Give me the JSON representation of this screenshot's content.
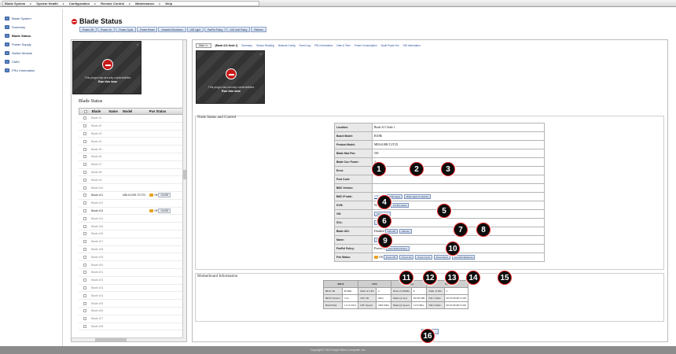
{
  "topbar": {
    "items": [
      "Blade System",
      "System Health",
      "Configuration",
      "Remote Control",
      "Maintenance",
      "Help"
    ]
  },
  "nav": {
    "items": [
      {
        "label": "Blade System",
        "active": false
      },
      {
        "label": "Summary",
        "active": false
      },
      {
        "label": "Blade Status",
        "active": true
      },
      {
        "label": "Power Supply",
        "active": false
      },
      {
        "label": "Switch Module",
        "active": false
      },
      {
        "label": "CMM",
        "active": false
      },
      {
        "label": "FRU Information",
        "active": false
      }
    ]
  },
  "header": {
    "title": "Blade Status",
    "power_buttons": [
      "Power Off",
      "Power On",
      "Power Cycle",
      "Power Reset",
      "Graceful Shutdown",
      "UID Light",
      "PwrPol Policy",
      "UID Ledt Policy",
      "Refresh"
    ]
  },
  "plugin": {
    "message": "This plugin has security vulnerabilities",
    "action": "Run this time",
    "close": "×"
  },
  "blade_status": {
    "title": "Blade Status",
    "columns": [
      "Blade",
      "Name",
      "Model",
      "Pwr Status"
    ],
    "rows": [
      {
        "blade": "Blade #1",
        "model": "",
        "pwr": ""
      },
      {
        "blade": "Blade #2",
        "model": "",
        "pwr": ""
      },
      {
        "blade": "Blade #3",
        "model": "",
        "pwr": ""
      },
      {
        "blade": "Blade #4",
        "model": "",
        "pwr": ""
      },
      {
        "blade": "Blade #5",
        "model": "",
        "pwr": ""
      },
      {
        "blade": "Blade #6",
        "model": "",
        "pwr": ""
      },
      {
        "blade": "Blade #7",
        "model": "",
        "pwr": ""
      },
      {
        "blade": "Blade #8",
        "model": "",
        "pwr": ""
      },
      {
        "blade": "Blade #9",
        "model": "",
        "pwr": ""
      },
      {
        "blade": "Blade #10",
        "model": "",
        "pwr": ""
      },
      {
        "blade": "Blade #11",
        "model": "MBI-6128R-T2/T2X",
        "pwr": "Off",
        "onoff": "On/Off",
        "highlight": true
      },
      {
        "blade": "Blade #12",
        "model": "",
        "pwr": ""
      },
      {
        "blade": "Blade #13",
        "model": "",
        "pwr": "Off",
        "onoff": "On/Off",
        "highlight": true
      },
      {
        "blade": "Blade #14",
        "model": "",
        "pwr": ""
      },
      {
        "blade": "Blade #15",
        "model": "",
        "pwr": ""
      },
      {
        "blade": "Blade #16",
        "model": "",
        "pwr": ""
      },
      {
        "blade": "Blade #17",
        "model": "",
        "pwr": ""
      },
      {
        "blade": "Blade #18",
        "model": "",
        "pwr": ""
      },
      {
        "blade": "Blade #19",
        "model": "",
        "pwr": ""
      },
      {
        "blade": "Blade #20",
        "model": "",
        "pwr": ""
      },
      {
        "blade": "Blade #21",
        "model": "",
        "pwr": ""
      },
      {
        "blade": "Blade #22",
        "model": "",
        "pwr": ""
      },
      {
        "blade": "Blade #23",
        "model": "",
        "pwr": ""
      },
      {
        "blade": "Blade #24",
        "model": "",
        "pwr": ""
      },
      {
        "blade": "Blade #25",
        "model": "",
        "pwr": ""
      },
      {
        "blade": "Blade #26",
        "model": "",
        "pwr": ""
      },
      {
        "blade": "Blade #27",
        "model": "",
        "pwr": ""
      },
      {
        "blade": "Blade #28",
        "model": "",
        "pwr": ""
      }
    ]
  },
  "main": {
    "hide_button": "Hide <<",
    "node_heading": "[Blade A11 Node 1]",
    "tabs": [
      "Summary",
      "Sensor Reading",
      "Network Config",
      "Event Log",
      "FRU Information",
      "Date & Time",
      "Power Consumption",
      "Node Power Hw",
      "HW Information"
    ],
    "node_section_title": "Node Status and Control",
    "node_info": [
      {
        "key": "Location:",
        "value": "Blade A11 Node 1"
      },
      {
        "key": "Board Model:",
        "value": "B1DRi"
      },
      {
        "key": "Product Model:",
        "value": "MBI-6128R-T2/T2X"
      },
      {
        "key": "Blade Max Pwr:",
        "value": "500"
      },
      {
        "key": "Blade Curr Power:",
        "value": "4"
      },
      {
        "key": "Error:",
        "value": ""
      },
      {
        "key": "Post Code:",
        "value": ""
      },
      {
        "key": "BMC Version:",
        "value": ""
      },
      {
        "key": "BMC IP addr:",
        "value": "172.31.42.",
        "buttons": [
          "BMC Reset",
          "BMC Reset To Default"
        ]
      },
      {
        "key": "KVM:",
        "value": "Not Launched",
        "buttons": [
          "KVM Launch"
        ]
      },
      {
        "key": "VM:",
        "value": "",
        "buttons": [
          "VM Launch"
        ]
      },
      {
        "key": "SOL:",
        "value": "",
        "buttons": [
          "SOL Launch"
        ]
      },
      {
        "key": "Blade UID:",
        "value": "Disabled",
        "buttons": [
          "UID Off",
          "UID On"
        ]
      },
      {
        "key": "Name:",
        "value": "",
        "buttons": [
          "Save Name"
        ]
      },
      {
        "key": "PwrPol Policy:",
        "value": "PowerOff",
        "buttons": [
          "Save PwrPol Policy"
        ]
      },
      {
        "key": "Pwr Status:",
        "value": "Off",
        "buttons": [
          "Power Off",
          "Power On",
          "Power Cycle",
          "Power Reset",
          "Graceful Shutdown"
        ]
      }
    ],
    "mb_section_title": "Motherboard Information",
    "mb_headers": [
      "BIOS",
      "CPU",
      "Memory",
      "NIC"
    ],
    "mb_rows": [
      [
        "BIOS ID",
        "B1DRi",
        "Num of CPU",
        "2",
        "Num of DIMM",
        "8",
        "Num of NIC",
        "2"
      ],
      [
        "BIOS Version",
        "1.0a",
        "CPU ID",
        "0402",
        "Memory Size",
        "65536 MB",
        "NIC1 MAC",
        "00:25:90:4E:51:68"
      ],
      [
        "Build Date",
        "11/11/2014",
        "CPU Speed",
        "1800 Mhz",
        "Memory Speed",
        "2133 Mhz",
        "NIC2 MAC",
        "00:25:90:4E:51:69"
      ]
    ],
    "refresh": "Refresh"
  },
  "footer": {
    "copyright": "Copyright © 2013 Super Micro Computer, Inc."
  },
  "callouts": [
    "1",
    "2",
    "3",
    "4",
    "5",
    "6",
    "7",
    "8",
    "9",
    "10",
    "11",
    "12",
    "13",
    "14",
    "15",
    "16"
  ]
}
